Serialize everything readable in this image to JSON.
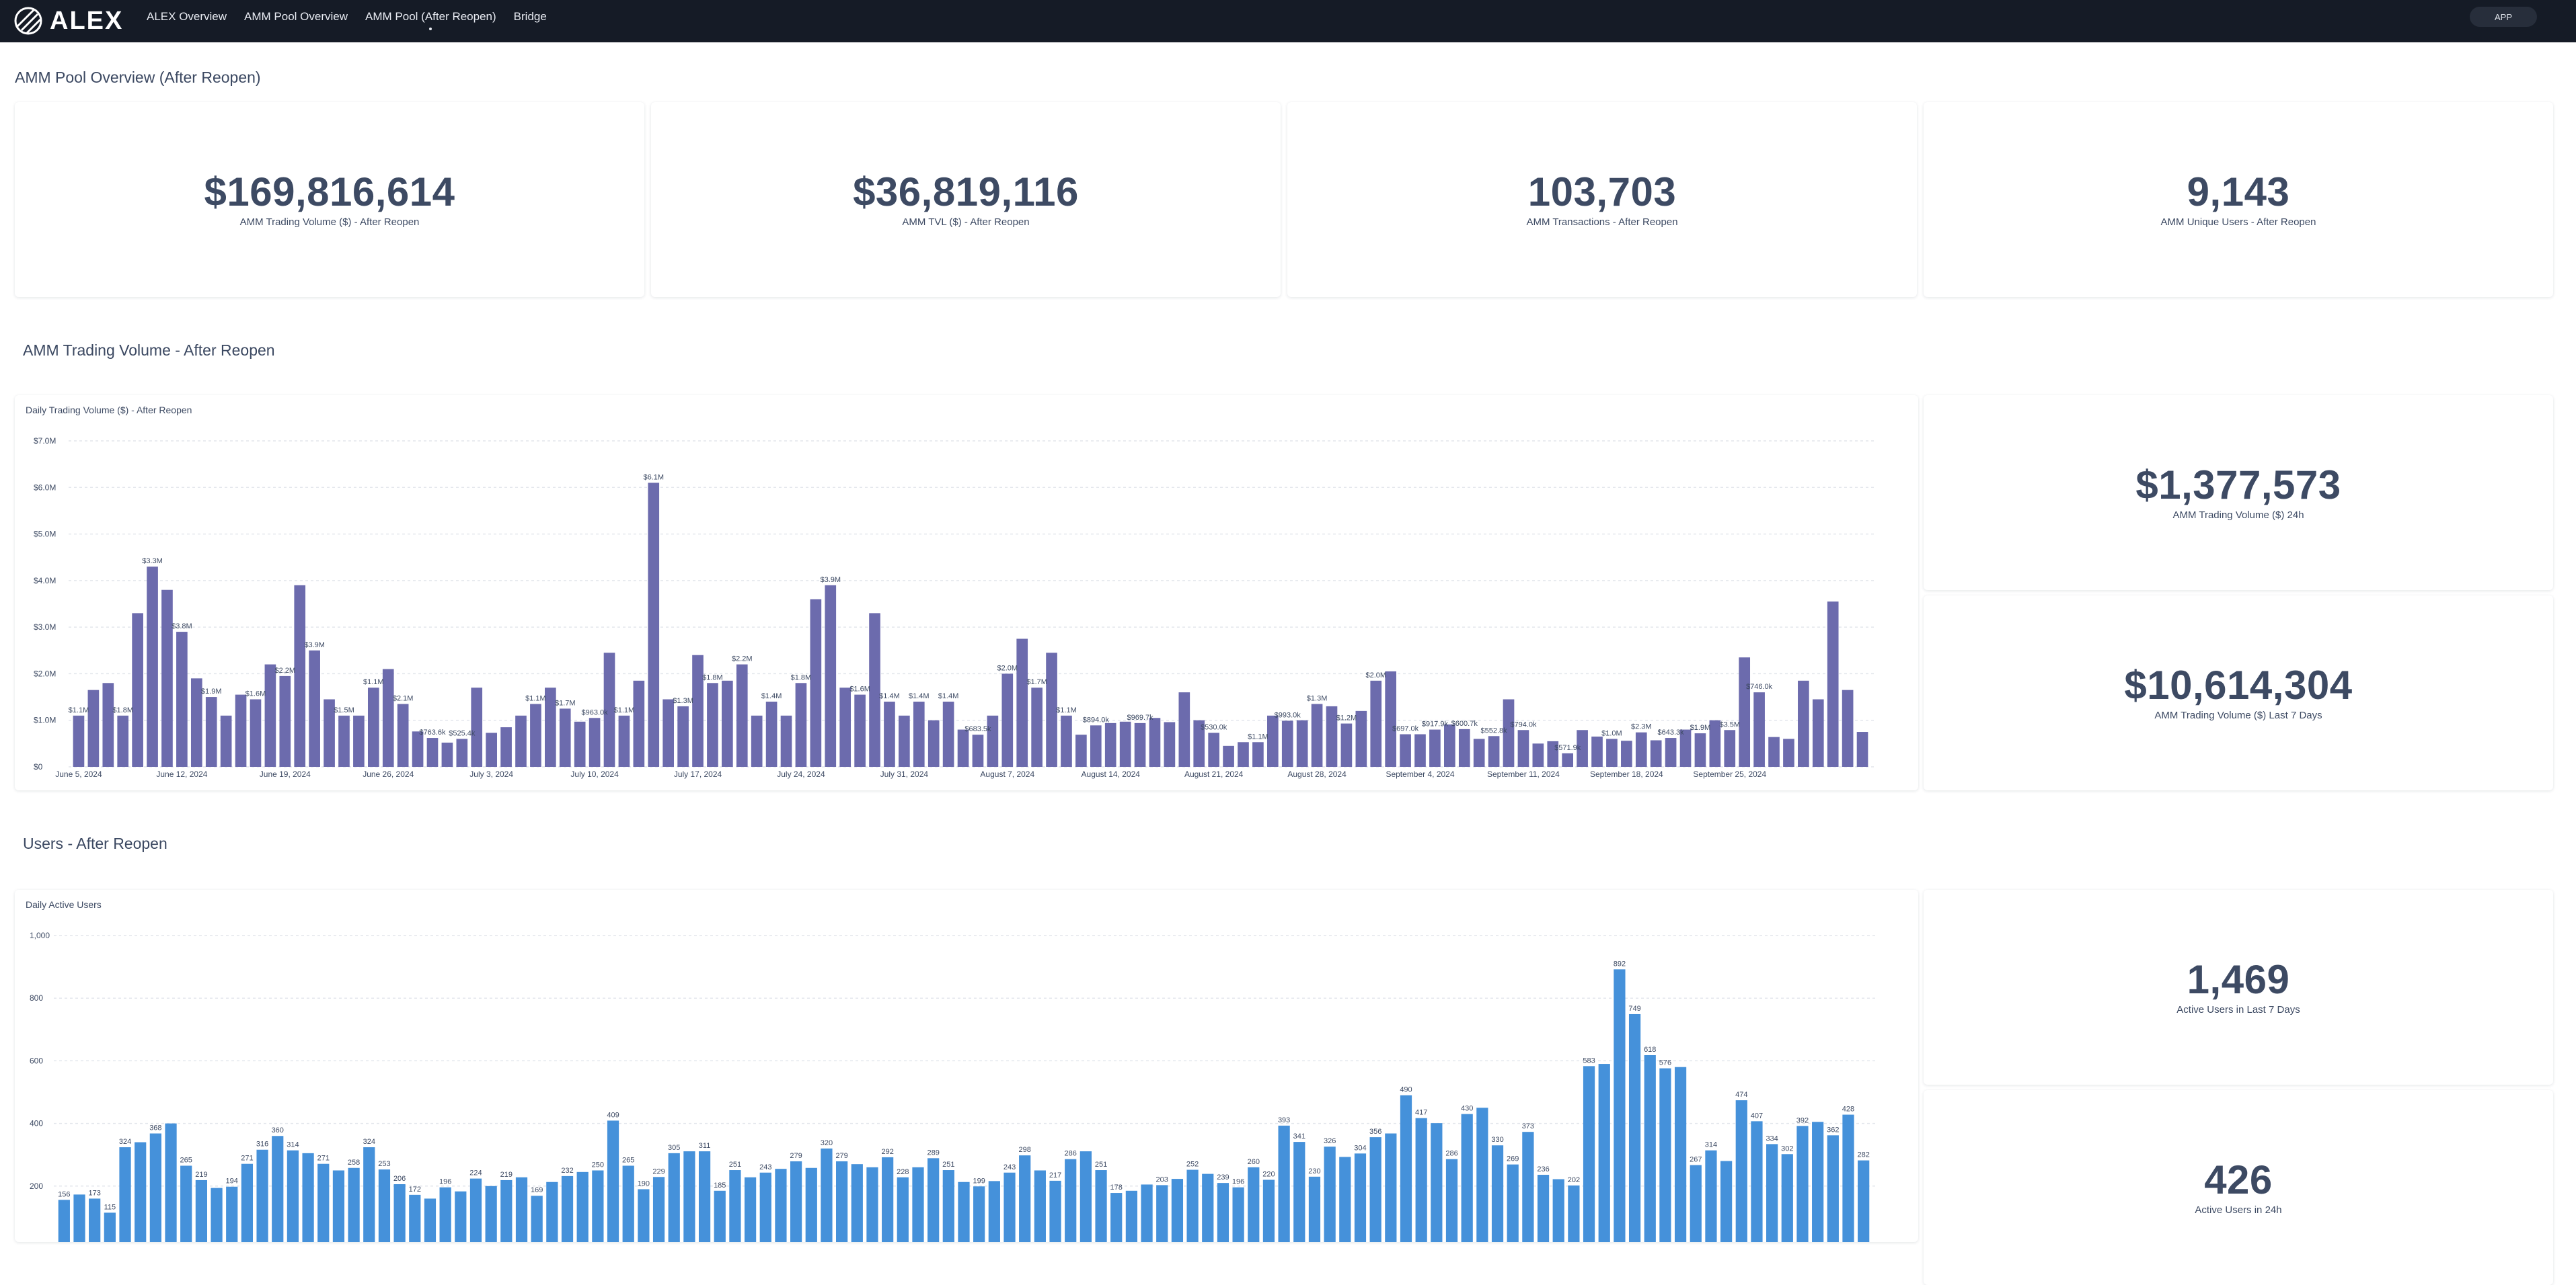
{
  "nav": {
    "logo_text": "ALEX",
    "items": [
      "ALEX Overview",
      "AMM Pool Overview",
      "AMM Pool (After Reopen)",
      "Bridge"
    ],
    "app_button": "APP"
  },
  "overview": {
    "title": "AMM Pool Overview (After Reopen)",
    "kpis": [
      {
        "value": "$169,816,614",
        "label": "AMM Trading Volume ($) - After Reopen"
      },
      {
        "value": "$36,819,116",
        "label": "AMM TVL ($) - After Reopen"
      },
      {
        "value": "103,703",
        "label": "AMM Transactions - After Reopen"
      },
      {
        "value": "9,143",
        "label": "AMM Unique Users - After Reopen"
      }
    ]
  },
  "volume_section": {
    "title": "AMM Trading Volume - After Reopen",
    "chart_title": "Daily Trading Volume ($) - After Reopen",
    "kpis": [
      {
        "value": "$1,377,573",
        "label": "AMM Trading Volume ($) 24h"
      },
      {
        "value": "$10,614,304",
        "label": "AMM Trading Volume ($) Last 7 Days"
      }
    ]
  },
  "users_section": {
    "title": "Users - After Reopen",
    "chart_title": "Daily Active Users",
    "kpis": [
      {
        "value": "1,469",
        "label": "Active Users in Last 7 Days"
      },
      {
        "value": "426",
        "label": "Active Users in 24h"
      }
    ]
  },
  "chart_data": [
    {
      "type": "bar",
      "title": "Daily Trading Volume ($) - After Reopen",
      "color": "#6c6bad",
      "ylim": [
        0,
        7000000
      ],
      "yticks": [
        {
          "v": 0,
          "t": "$0"
        },
        {
          "v": 1000000,
          "t": "$1.0M"
        },
        {
          "v": 2000000,
          "t": "$2.0M"
        },
        {
          "v": 3000000,
          "t": "$3.0M"
        },
        {
          "v": 4000000,
          "t": "$4.0M"
        },
        {
          "v": 5000000,
          "t": "$5.0M"
        },
        {
          "v": 6000000,
          "t": "$6.0M"
        },
        {
          "v": 7000000,
          "t": "$7.0M"
        }
      ],
      "xticks": [
        {
          "i": 0,
          "t": "June 5, 2024"
        },
        {
          "i": 7,
          "t": "June 12, 2024"
        },
        {
          "i": 14,
          "t": "June 19, 2024"
        },
        {
          "i": 21,
          "t": "June 26, 2024"
        },
        {
          "i": 28,
          "t": "July 3, 2024"
        },
        {
          "i": 35,
          "t": "July 10, 2024"
        },
        {
          "i": 42,
          "t": "July 17, 2024"
        },
        {
          "i": 49,
          "t": "July 24, 2024"
        },
        {
          "i": 56,
          "t": "July 31, 2024"
        },
        {
          "i": 63,
          "t": "August 7, 2024"
        },
        {
          "i": 70,
          "t": "August 14, 2024"
        },
        {
          "i": 77,
          "t": "August 21, 2024"
        },
        {
          "i": 84,
          "t": "August 28, 2024"
        },
        {
          "i": 91,
          "t": "September 4, 2024"
        },
        {
          "i": 98,
          "t": "September 11, 2024"
        },
        {
          "i": 105,
          "t": "September 18, 2024"
        },
        {
          "i": 112,
          "t": "September 25, 2024"
        }
      ],
      "values": [
        1100000,
        1650000,
        1800000,
        1100000,
        3300000,
        4300000,
        3800000,
        2900000,
        1900000,
        1500000,
        1100000,
        1550000,
        1450000,
        2200000,
        1950000,
        3900000,
        2500000,
        1450000,
        1100000,
        1100000,
        1700000,
        2100000,
        1350000,
        760000,
        620000,
        520000,
        600000,
        1700000,
        730000,
        850000,
        1100000,
        1350000,
        1700000,
        1250000,
        970000,
        1050000,
        2450000,
        1100000,
        1850000,
        6100000,
        1450000,
        1300000,
        2400000,
        1800000,
        1850000,
        2200000,
        1100000,
        1400000,
        1100000,
        1800000,
        3600000,
        3900000,
        1700000,
        1550000,
        3300000,
        1400000,
        1100000,
        1400000,
        1000000,
        1400000,
        800000,
        690000,
        1100000,
        2000000,
        2750000,
        1700000,
        2450000,
        1100000,
        690000,
        890000,
        940000,
        970000,
        940000,
        1050000,
        960000,
        1600000,
        1000000,
        730000,
        450000,
        530000,
        530000,
        1100000,
        990000,
        1000000,
        1350000,
        1300000,
        930000,
        1200000,
        1850000,
        2050000,
        700000,
        700000,
        800000,
        910000,
        810000,
        600000,
        660000,
        1450000,
        790000,
        500000,
        550000,
        290000,
        790000,
        650000,
        600000,
        560000,
        740000,
        570000,
        620000,
        800000,
        720000,
        1000000,
        790000,
        2350000,
        1600000,
        640000,
        600000,
        1850000,
        1450000,
        3550000,
        1650000,
        750000
      ],
      "data_labels": [
        {
          "i": 0,
          "t": "$1.1M"
        },
        {
          "i": 3,
          "t": "$1.8M"
        },
        {
          "i": 5,
          "t": "$3.3M"
        },
        {
          "i": 7,
          "t": "$3.8M"
        },
        {
          "i": 9,
          "t": "$1.9M"
        },
        {
          "i": 12,
          "t": "$1.6M"
        },
        {
          "i": 14,
          "t": "$2.2M"
        },
        {
          "i": 16,
          "t": "$3.9M"
        },
        {
          "i": 18,
          "t": "$1.5M"
        },
        {
          "i": 20,
          "t": "$1.1M"
        },
        {
          "i": 22,
          "t": "$2.1M"
        },
        {
          "i": 24,
          "t": "$763.6k"
        },
        {
          "i": 26,
          "t": "$525.4k"
        },
        {
          "i": 31,
          "t": "$1.1M"
        },
        {
          "i": 33,
          "t": "$1.7M"
        },
        {
          "i": 35,
          "t": "$963.0k"
        },
        {
          "i": 37,
          "t": "$1.1M"
        },
        {
          "i": 39,
          "t": "$6.1M"
        },
        {
          "i": 41,
          "t": "$1.3M"
        },
        {
          "i": 43,
          "t": "$1.8M"
        },
        {
          "i": 45,
          "t": "$2.2M"
        },
        {
          "i": 47,
          "t": "$1.4M"
        },
        {
          "i": 49,
          "t": "$1.8M"
        },
        {
          "i": 51,
          "t": "$3.9M"
        },
        {
          "i": 53,
          "t": "$1.6M"
        },
        {
          "i": 55,
          "t": "$1.4M"
        },
        {
          "i": 57,
          "t": "$1.4M"
        },
        {
          "i": 59,
          "t": "$1.4M"
        },
        {
          "i": 61,
          "t": "$683.5k"
        },
        {
          "i": 63,
          "t": "$2.0M"
        },
        {
          "i": 65,
          "t": "$1.7M"
        },
        {
          "i": 67,
          "t": "$1.1M"
        },
        {
          "i": 69,
          "t": "$894.0k"
        },
        {
          "i": 72,
          "t": "$969.7k"
        },
        {
          "i": 77,
          "t": "$530.0k"
        },
        {
          "i": 80,
          "t": "$1.1M"
        },
        {
          "i": 82,
          "t": "$993.0k"
        },
        {
          "i": 84,
          "t": "$1.3M"
        },
        {
          "i": 86,
          "t": "$1.2M"
        },
        {
          "i": 88,
          "t": "$2.0M"
        },
        {
          "i": 90,
          "t": "$697.0k"
        },
        {
          "i": 92,
          "t": "$917.9k"
        },
        {
          "i": 94,
          "t": "$600.7k"
        },
        {
          "i": 96,
          "t": "$552.8k"
        },
        {
          "i": 98,
          "t": "$794.0k"
        },
        {
          "i": 101,
          "t": "$571.9k"
        },
        {
          "i": 104,
          "t": "$1.0M"
        },
        {
          "i": 106,
          "t": "$2.3M"
        },
        {
          "i": 108,
          "t": "$643.3k"
        },
        {
          "i": 110,
          "t": "$1.9M"
        },
        {
          "i": 112,
          "t": "$3.5M"
        },
        {
          "i": 114,
          "t": "$746.0k"
        }
      ]
    },
    {
      "type": "bar",
      "title": "Daily Active Users",
      "color": "#4591da",
      "ylim": [
        0,
        1000
      ],
      "yticks": [
        {
          "v": 200,
          "t": "200"
        },
        {
          "v": 400,
          "t": "400"
        },
        {
          "v": 600,
          "t": "600"
        },
        {
          "v": 800,
          "t": "800"
        },
        {
          "v": 1000,
          "t": "1,000"
        }
      ],
      "values": [
        156,
        173,
        160,
        115,
        324,
        340,
        368,
        400,
        265,
        219,
        194,
        198,
        271,
        316,
        360,
        314,
        305,
        271,
        250,
        258,
        324,
        253,
        206,
        172,
        160,
        196,
        183,
        224,
        200,
        219,
        228,
        169,
        213,
        232,
        245,
        250,
        409,
        265,
        190,
        229,
        305,
        311,
        311,
        185,
        251,
        228,
        243,
        255,
        279,
        258,
        320,
        279,
        270,
        260,
        292,
        228,
        260,
        289,
        251,
        213,
        199,
        216,
        243,
        298,
        250,
        217,
        286,
        311,
        251,
        178,
        185,
        205,
        203,
        223,
        252,
        239,
        210,
        196,
        260,
        220,
        393,
        341,
        230,
        326,
        293,
        304,
        356,
        368,
        490,
        417,
        401,
        286,
        430,
        450,
        330,
        269,
        373,
        236,
        222,
        202,
        583,
        590,
        892,
        749,
        618,
        576,
        580,
        267,
        314,
        280,
        474,
        407,
        334,
        302,
        392,
        405,
        362,
        428,
        282
      ],
      "data_labels": [
        {
          "i": 0,
          "t": "156"
        },
        {
          "i": 2,
          "t": "173"
        },
        {
          "i": 3,
          "t": "115"
        },
        {
          "i": 4,
          "t": "324"
        },
        {
          "i": 6,
          "t": "368"
        },
        {
          "i": 8,
          "t": "265"
        },
        {
          "i": 9,
          "t": "219"
        },
        {
          "i": 11,
          "t": "194"
        },
        {
          "i": 12,
          "t": "271"
        },
        {
          "i": 13,
          "t": "316"
        },
        {
          "i": 14,
          "t": "360"
        },
        {
          "i": 15,
          "t": "314"
        },
        {
          "i": 17,
          "t": "271"
        },
        {
          "i": 19,
          "t": "258"
        },
        {
          "i": 20,
          "t": "324"
        },
        {
          "i": 21,
          "t": "253"
        },
        {
          "i": 22,
          "t": "206"
        },
        {
          "i": 23,
          "t": "172"
        },
        {
          "i": 25,
          "t": "196"
        },
        {
          "i": 27,
          "t": "224"
        },
        {
          "i": 29,
          "t": "219"
        },
        {
          "i": 31,
          "t": "169"
        },
        {
          "i": 33,
          "t": "232"
        },
        {
          "i": 35,
          "t": "250"
        },
        {
          "i": 36,
          "t": "409"
        },
        {
          "i": 37,
          "t": "265"
        },
        {
          "i": 38,
          "t": "190"
        },
        {
          "i": 39,
          "t": "229"
        },
        {
          "i": 40,
          "t": "305"
        },
        {
          "i": 42,
          "t": "311"
        },
        {
          "i": 43,
          "t": "185"
        },
        {
          "i": 44,
          "t": "251"
        },
        {
          "i": 46,
          "t": "243"
        },
        {
          "i": 48,
          "t": "279"
        },
        {
          "i": 50,
          "t": "320"
        },
        {
          "i": 51,
          "t": "279"
        },
        {
          "i": 54,
          "t": "292"
        },
        {
          "i": 55,
          "t": "228"
        },
        {
          "i": 57,
          "t": "289"
        },
        {
          "i": 58,
          "t": "251"
        },
        {
          "i": 60,
          "t": "199"
        },
        {
          "i": 62,
          "t": "243"
        },
        {
          "i": 63,
          "t": "298"
        },
        {
          "i": 65,
          "t": "217"
        },
        {
          "i": 66,
          "t": "286"
        },
        {
          "i": 68,
          "t": "251"
        },
        {
          "i": 69,
          "t": "178"
        },
        {
          "i": 72,
          "t": "203"
        },
        {
          "i": 74,
          "t": "252"
        },
        {
          "i": 76,
          "t": "239"
        },
        {
          "i": 77,
          "t": "196"
        },
        {
          "i": 78,
          "t": "260"
        },
        {
          "i": 79,
          "t": "220"
        },
        {
          "i": 80,
          "t": "393"
        },
        {
          "i": 81,
          "t": "341"
        },
        {
          "i": 82,
          "t": "230"
        },
        {
          "i": 83,
          "t": "326"
        },
        {
          "i": 85,
          "t": "304"
        },
        {
          "i": 86,
          "t": "356"
        },
        {
          "i": 88,
          "t": "490"
        },
        {
          "i": 89,
          "t": "417"
        },
        {
          "i": 91,
          "t": "286"
        },
        {
          "i": 92,
          "t": "430"
        },
        {
          "i": 94,
          "t": "330"
        },
        {
          "i": 95,
          "t": "269"
        },
        {
          "i": 96,
          "t": "373"
        },
        {
          "i": 97,
          "t": "236"
        },
        {
          "i": 99,
          "t": "202"
        },
        {
          "i": 100,
          "t": "583"
        },
        {
          "i": 102,
          "t": "892"
        },
        {
          "i": 103,
          "t": "749"
        },
        {
          "i": 104,
          "t": "618"
        },
        {
          "i": 105,
          "t": "576"
        },
        {
          "i": 107,
          "t": "267"
        },
        {
          "i": 108,
          "t": "314"
        },
        {
          "i": 110,
          "t": "474"
        },
        {
          "i": 111,
          "t": "407"
        },
        {
          "i": 112,
          "t": "334"
        },
        {
          "i": 113,
          "t": "302"
        },
        {
          "i": 114,
          "t": "392"
        },
        {
          "i": 116,
          "t": "362"
        },
        {
          "i": 117,
          "t": "428"
        },
        {
          "i": 118,
          "t": "282"
        }
      ]
    }
  ]
}
